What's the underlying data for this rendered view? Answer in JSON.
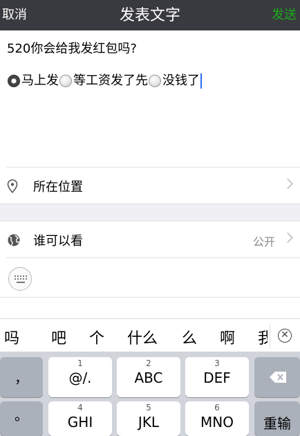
{
  "navbar": {
    "cancel": "取消",
    "title": "发表文字",
    "send": "发送"
  },
  "compose": {
    "question": "520你会给我发红包吗?",
    "options": [
      "马上发",
      "等工资发了先",
      "没钱了"
    ]
  },
  "location_row": {
    "label": "所在位置"
  },
  "visibility_row": {
    "label": "谁可以看",
    "value": "公开"
  },
  "candidates": [
    "吗",
    "吧",
    "个",
    "什么",
    "么",
    "啊",
    "我"
  ],
  "keyboard": {
    "left_keys": [
      "，",
      "。"
    ],
    "keys": [
      {
        "num": "1",
        "label": "@/."
      },
      {
        "num": "2",
        "label": "ABC"
      },
      {
        "num": "3",
        "label": "DEF"
      },
      {
        "num": "4",
        "label": "GHI"
      },
      {
        "num": "5",
        "label": "JKL"
      },
      {
        "num": "6",
        "label": "MNO"
      }
    ],
    "return_label": "重输"
  }
}
